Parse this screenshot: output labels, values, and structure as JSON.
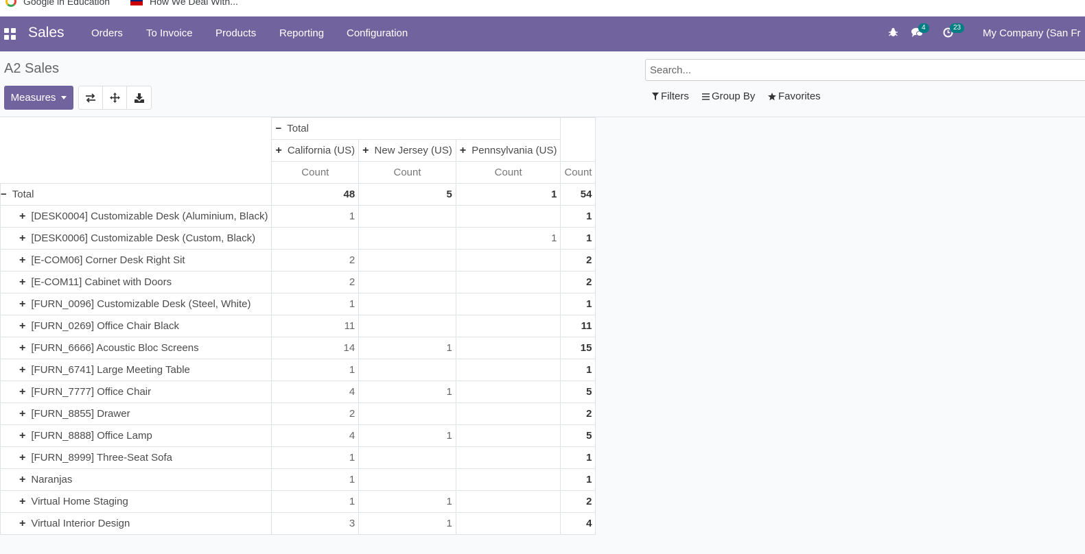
{
  "bookmarks": [
    {
      "label": "Google in Education",
      "icon": "google-icon"
    },
    {
      "label": "How We Deal With...",
      "icon": "flag-icon"
    }
  ],
  "navbar": {
    "brand": "Sales",
    "menu": [
      "Orders",
      "To Invoice",
      "Products",
      "Reporting",
      "Configuration"
    ],
    "messages_badge": "4",
    "activities_badge": "23",
    "company": "My Company (San Fr",
    "color": "#71639e"
  },
  "control_panel": {
    "title": "A2 Sales",
    "search_placeholder": "Search...",
    "measures_label": "Measures",
    "filters_label": "Filters",
    "group_by_label": "Group By",
    "favorites_label": "Favorites"
  },
  "pivot": {
    "col_total_label": "Total",
    "columns": [
      "California (US)",
      "New Jersey (US)",
      "Pennsylvania (US)"
    ],
    "measure": "Count",
    "row_total_label": "Total",
    "totals": [
      "48",
      "5",
      "1",
      "54"
    ],
    "rows": [
      {
        "label": "[DESK0004] Customizable Desk (Aluminium, Black)",
        "values": [
          "1",
          "",
          "",
          "1"
        ]
      },
      {
        "label": "[DESK0006] Customizable Desk (Custom, Black)",
        "values": [
          "",
          "",
          "1",
          "1"
        ]
      },
      {
        "label": "[E-COM06] Corner Desk Right Sit",
        "values": [
          "2",
          "",
          "",
          "2"
        ]
      },
      {
        "label": "[E-COM11] Cabinet with Doors",
        "values": [
          "2",
          "",
          "",
          "2"
        ]
      },
      {
        "label": "[FURN_0096] Customizable Desk (Steel, White)",
        "values": [
          "1",
          "",
          "",
          "1"
        ]
      },
      {
        "label": "[FURN_0269] Office Chair Black",
        "values": [
          "11",
          "",
          "",
          "11"
        ]
      },
      {
        "label": "[FURN_6666] Acoustic Bloc Screens",
        "values": [
          "14",
          "1",
          "",
          "15"
        ]
      },
      {
        "label": "[FURN_6741] Large Meeting Table",
        "values": [
          "1",
          "",
          "",
          "1"
        ]
      },
      {
        "label": "[FURN_7777] Office Chair",
        "values": [
          "4",
          "1",
          "",
          "5"
        ]
      },
      {
        "label": "[FURN_8855] Drawer",
        "values": [
          "2",
          "",
          "",
          "2"
        ]
      },
      {
        "label": "[FURN_8888] Office Lamp",
        "values": [
          "4",
          "1",
          "",
          "5"
        ]
      },
      {
        "label": "[FURN_8999] Three-Seat Sofa",
        "values": [
          "1",
          "",
          "",
          "1"
        ]
      },
      {
        "label": "Naranjas",
        "values": [
          "1",
          "",
          "",
          "1"
        ]
      },
      {
        "label": "Virtual Home Staging",
        "values": [
          "1",
          "1",
          "",
          "2"
        ]
      },
      {
        "label": "Virtual Interior Design",
        "values": [
          "3",
          "1",
          "",
          "4"
        ]
      }
    ]
  }
}
